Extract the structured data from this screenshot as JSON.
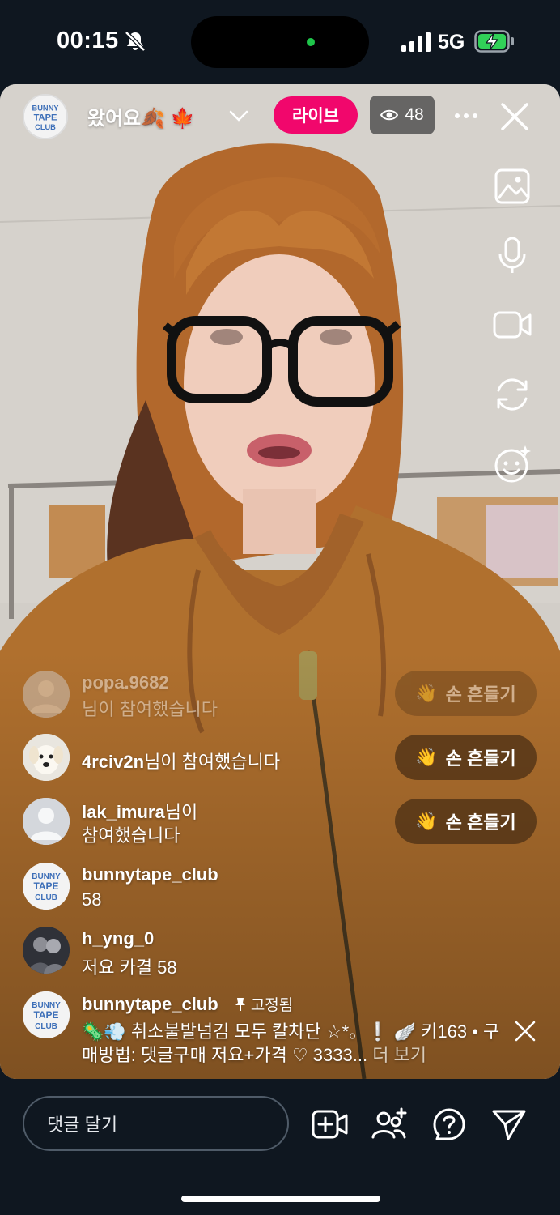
{
  "status_bar": {
    "time": "00:15",
    "network": "5G"
  },
  "live": {
    "host_title": "왔어요🍂 🍁  ",
    "live_label": "라이브",
    "viewer_count": "48"
  },
  "comments": [
    {
      "user": "popa.9682",
      "text": "님이 참여했습니다",
      "faded": true
    },
    {
      "user": "4rciv2n",
      "text": "님이 참여했습니다"
    },
    {
      "user": "lak_imura",
      "text": "님이",
      "text2": "참여했습니다"
    },
    {
      "user": "bunnytape_club",
      "text": "58"
    },
    {
      "user": "h_yng_0",
      "text": "저요 카결 58"
    },
    {
      "user": "bunnytape_club",
      "pin_label": "고정됨",
      "text": "🦠💨 취소불발넘김 모두 칼차단 ☆*。❕ 🪽 키163 • 구",
      "text2": "매방법: 댓글구매 저요+가격 ♡ 3333...",
      "more_label": "더 보기"
    }
  ],
  "wave_button_label": "손 흔들기",
  "wave_emoji": "👋",
  "comment_input": {
    "placeholder": "댓글 달기"
  },
  "colors": {
    "live_pink": "#f1076c",
    "background": "#0f1720"
  }
}
